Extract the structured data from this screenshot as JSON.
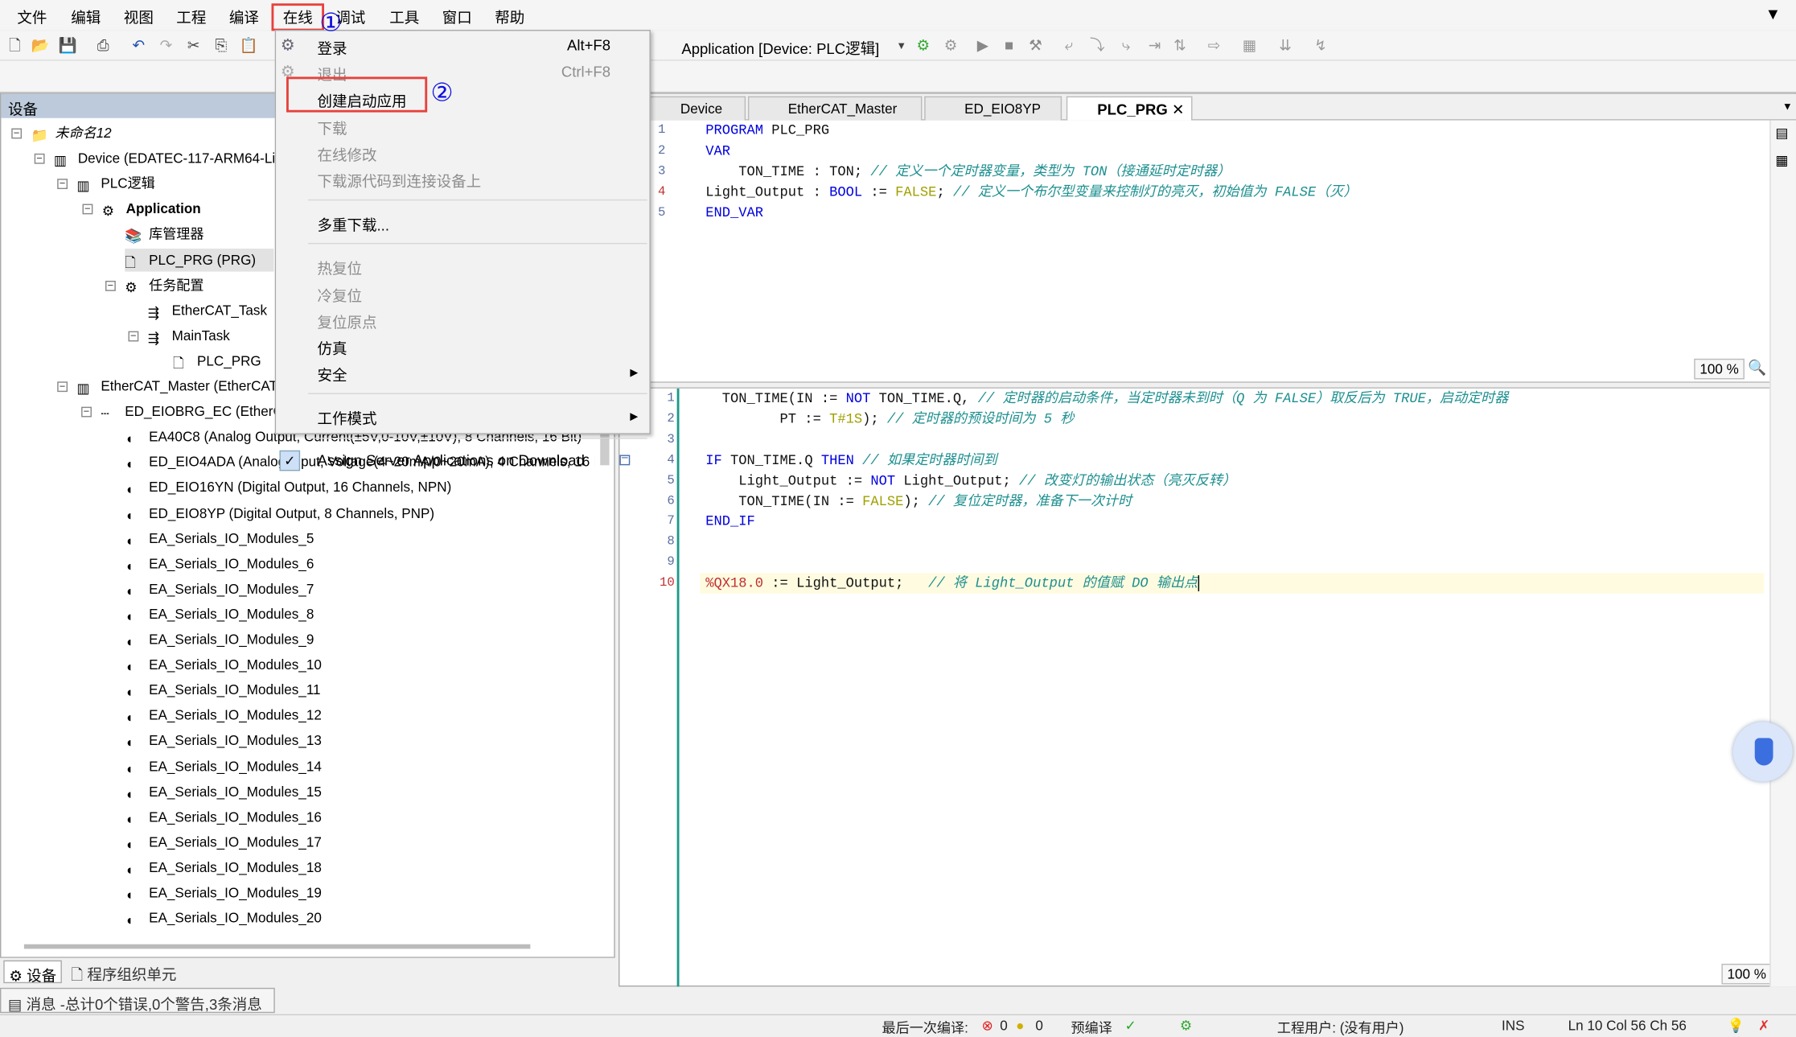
{
  "menubar": [
    "文件",
    "编辑",
    "视图",
    "工程",
    "编译",
    "在线",
    "调试",
    "工具",
    "窗口",
    "帮助"
  ],
  "annotations": {
    "step1": "①",
    "step2": "②"
  },
  "toolbar": {
    "app_selector": "Application [Device: PLC逻辑]"
  },
  "left_panel": {
    "title": "设备",
    "tree": [
      {
        "label": "未命名12",
        "italic": true
      },
      {
        "label": "Device (EDATEC-117-ARM64-Linux"
      },
      {
        "label": "PLC逻辑"
      },
      {
        "label": "Application",
        "bold": true
      },
      {
        "label": "库管理器"
      },
      {
        "label": "PLC_PRG (PRG)",
        "selected": true
      },
      {
        "label": "任务配置"
      },
      {
        "label": "EtherCAT_Task"
      },
      {
        "label": "MainTask"
      },
      {
        "label": "PLC_PRG"
      },
      {
        "label": "EtherCAT_Master (EtherCAT M"
      },
      {
        "label": "ED_EIOBRG_EC (EtherCA"
      },
      {
        "label": "EA40C8 (Analog Output, Current(±5V,0-10V,±10V), 8 Channels, 16 Bit)"
      },
      {
        "label": "ED_EIO4ADA (Analog Input, Voltage(4~20mA/0~20mA), 4 Channels, 16 Bit)"
      },
      {
        "label": "ED_EIO16YN (Digital Output, 16 Channels, NPN)"
      },
      {
        "label": "ED_EIO8YP (Digital Output, 8 Channels, PNP)"
      },
      {
        "label": "EA_Serials_IO_Modules_5"
      },
      {
        "label": "EA_Serials_IO_Modules_6"
      },
      {
        "label": "EA_Serials_IO_Modules_7"
      },
      {
        "label": "EA_Serials_IO_Modules_8"
      },
      {
        "label": "EA_Serials_IO_Modules_9"
      },
      {
        "label": "EA_Serials_IO_Modules_10"
      },
      {
        "label": "EA_Serials_IO_Modules_11"
      },
      {
        "label": "EA_Serials_IO_Modules_12"
      },
      {
        "label": "EA_Serials_IO_Modules_13"
      },
      {
        "label": "EA_Serials_IO_Modules_14"
      },
      {
        "label": "EA_Serials_IO_Modules_15"
      },
      {
        "label": "EA_Serials_IO_Modules_16"
      },
      {
        "label": "EA_Serials_IO_Modules_17"
      },
      {
        "label": "EA_Serials_IO_Modules_18"
      },
      {
        "label": "EA_Serials_IO_Modules_19"
      },
      {
        "label": "EA_Serials_IO_Modules_20"
      }
    ],
    "bottom_tabs": [
      "设备",
      "程序组织单元"
    ]
  },
  "messages": "消息 -总计0个错误,0个警告,3条消息",
  "editor": {
    "tabs": [
      "Device",
      "EtherCAT_Master",
      "ED_EIO8YP",
      "PLC_PRG"
    ],
    "active_tab": "PLC_PRG",
    "zoom_top": "100 %",
    "zoom_bottom": "100 %",
    "decl": [
      [
        [
          "kw",
          "PROGRAM "
        ],
        [
          "id",
          "PLC_PRG"
        ]
      ],
      [
        [
          "kw",
          "VAR"
        ]
      ],
      [
        [
          "id",
          "    TON_TIME : "
        ],
        [
          "id",
          "TON; "
        ],
        [
          "cm",
          "// 定义一个定时器变量，类型为 TON（接通延时定时器）"
        ]
      ],
      [
        [
          "id",
          "Light_Output : "
        ],
        [
          "kw",
          "BOOL"
        ],
        [
          "id",
          " := "
        ],
        [
          "lit",
          "FALSE"
        ],
        [
          "id",
          "; "
        ],
        [
          "cm",
          "// 定义一个布尔型变量来控制灯的亮灭，初始值为 FALSE（灭）"
        ]
      ],
      [
        [
          "kw",
          "END_VAR"
        ]
      ]
    ],
    "body": [
      [
        [
          "id",
          "  TON_TIME(IN := "
        ],
        [
          "kw",
          "NOT"
        ],
        [
          "id",
          " TON_TIME.Q, "
        ],
        [
          "cm",
          "// 定时器的启动条件，当定时器未到时（Q 为 FALSE）取反后为 TRUE，启动定时器"
        ]
      ],
      [
        [
          "id",
          "         PT := "
        ],
        [
          "lit",
          "T#1S"
        ],
        [
          "id",
          "); "
        ],
        [
          "cm",
          "// 定时器的预设时间为 5 秒"
        ]
      ],
      [],
      [
        [
          "kw",
          "IF"
        ],
        [
          "id",
          " TON_TIME.Q "
        ],
        [
          "kw",
          "THEN"
        ],
        [
          "id",
          " "
        ],
        [
          "cm",
          "// 如果定时器时间到"
        ]
      ],
      [
        [
          "id",
          "    Light_Output := "
        ],
        [
          "kw",
          "NOT"
        ],
        [
          "id",
          " Light_Output; "
        ],
        [
          "cm",
          "// 改变灯的输出状态（亮灭反转）"
        ]
      ],
      [
        [
          "id",
          "    TON_TIME(IN := "
        ],
        [
          "lit",
          "FALSE"
        ],
        [
          "id",
          "); "
        ],
        [
          "cm",
          "// 复位定时器，准备下一次计时"
        ]
      ],
      [
        [
          "kw",
          "END_IF"
        ]
      ],
      [],
      [],
      [
        [
          "addr",
          "%QX18.0"
        ],
        [
          "id",
          " := Light_Output;   "
        ],
        [
          "cm",
          "// 将 Light_Output 的值赋 DO 输出点"
        ]
      ]
    ]
  },
  "online_menu": [
    {
      "label": "登录",
      "shortcut": "Alt+F8",
      "icon": "login-icon"
    },
    {
      "label": "退出",
      "shortcut": "Ctrl+F8",
      "disabled": true,
      "icon": "logout-icon"
    },
    {
      "label": "创建启动应用"
    },
    {
      "label": "下载",
      "disabled": true
    },
    {
      "label": "在线修改",
      "disabled": true
    },
    {
      "label": "下载源代码到连接设备上",
      "disabled": true
    },
    {
      "sep": true
    },
    {
      "label": "多重下载..."
    },
    {
      "sep": true
    },
    {
      "label": "热复位",
      "disabled": true
    },
    {
      "label": "冷复位",
      "disabled": true
    },
    {
      "label": "复位原点",
      "disabled": true
    },
    {
      "label": "仿真"
    },
    {
      "label": "安全",
      "submenu": true
    },
    {
      "sep": true
    },
    {
      "label": "工作模式",
      "submenu": true
    },
    {
      "sep": true
    },
    {
      "label": "Assign Server Applications on Download",
      "checked": true
    }
  ],
  "status": {
    "last_build": "最后一次编译:",
    "errors": "0",
    "warnings": "0",
    "precompile": "预编译",
    "precompile_ok": "✓",
    "project_user": "工程用户: (没有用户)",
    "mode": "INS",
    "cursor": "Ln 10  Col 56  Ch 56"
  },
  "colors": {
    "highlight_border": "#e8413c",
    "annotation": "#1010e0",
    "current_line": "#fffbe0"
  }
}
